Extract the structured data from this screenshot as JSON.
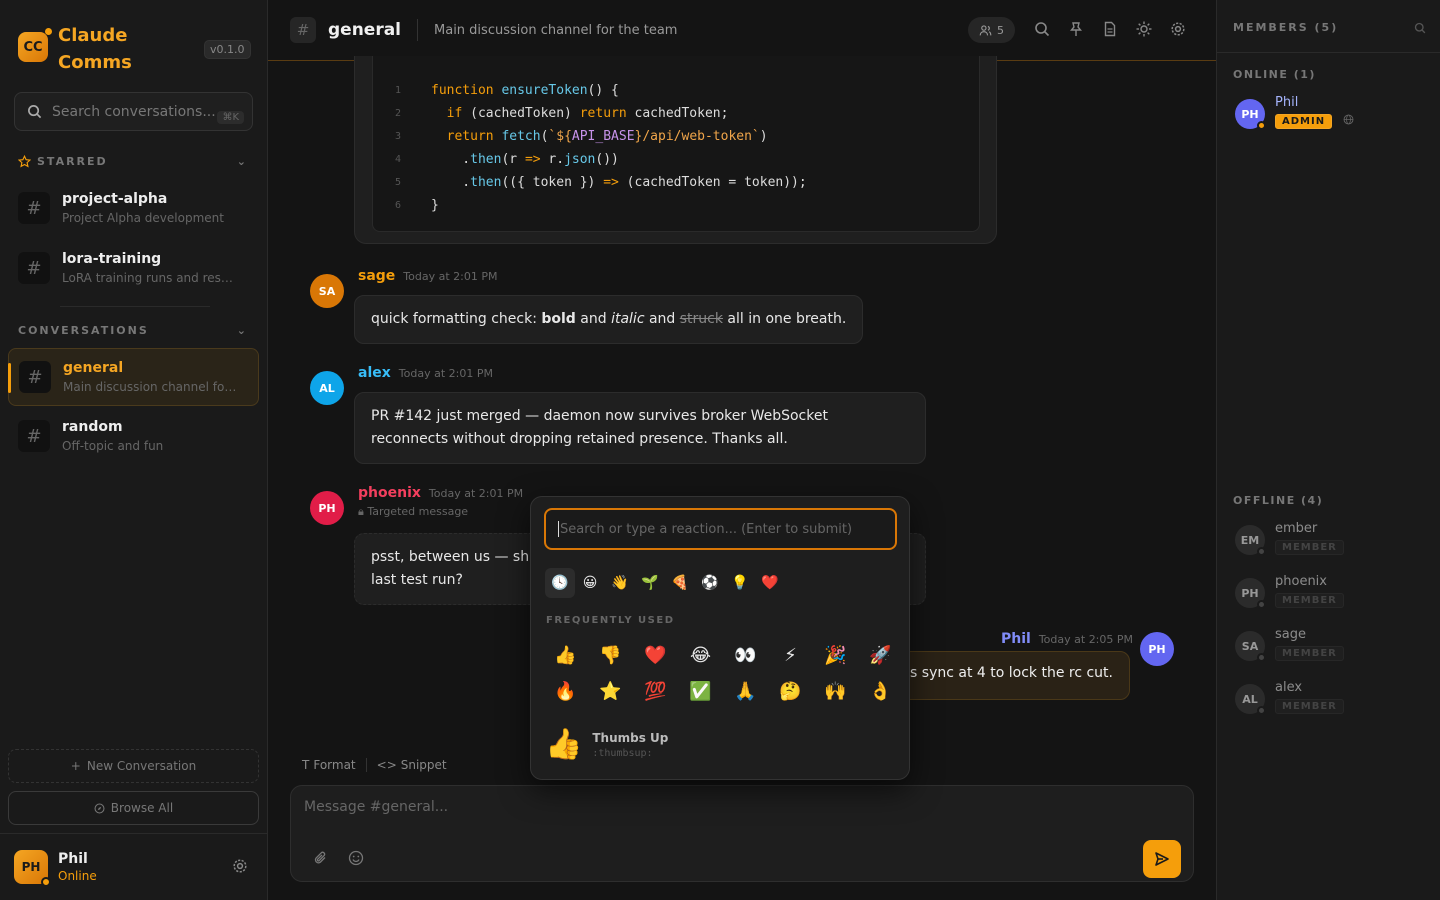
{
  "app": {
    "logo_initials": "CC",
    "name": "Claude Comms",
    "version": "v0.1.0",
    "accent": "#f59e0b"
  },
  "search": {
    "placeholder": "Search conversations...",
    "shortcut": "⌘K"
  },
  "starred": {
    "title": "STARRED",
    "items": [
      {
        "name": "project-alpha",
        "desc": "Project Alpha development"
      },
      {
        "name": "lora-training",
        "desc": "LoRA training runs and results"
      }
    ]
  },
  "conversations": {
    "title": "CONVERSATIONS",
    "items": [
      {
        "name": "general",
        "desc": "Main discussion channel for ..."
      },
      {
        "name": "random",
        "desc": "Off-topic and fun"
      }
    ]
  },
  "sidebar_actions": {
    "new": "New Conversation",
    "browse": "Browse All"
  },
  "user": {
    "initials": "PH",
    "name": "Phil",
    "status": "Online"
  },
  "channel": {
    "name": "general",
    "desc": "Main discussion channel for the team",
    "member_count": "5"
  },
  "code": {
    "lines": [
      "1",
      "2",
      "3",
      "4",
      "5",
      "6"
    ]
  },
  "messages": [
    {
      "initials": "SA",
      "author": "sage",
      "time": "Today at 2:01 PM",
      "pre": "quick formatting check: ",
      "bold": "bold",
      "mid1": " and ",
      "italic": "italic",
      "mid2": " and ",
      "strike": "struck",
      "post": " all in one breath."
    },
    {
      "initials": "AL",
      "author": "alex",
      "time": "Today at 2:01 PM",
      "line1": "PR #142 just merged — daemon now survives broker WebSocket",
      "line2": "reconnects without dropping retained presence. Thanks all."
    },
    {
      "initials": "PH",
      "author": "phoenix",
      "time": "Today at 2:01 PM",
      "targeted": "Targeted message",
      "line1": "psst, between us — sh",
      "line2": "last test run?"
    },
    {
      "initials": "PH",
      "author": "Phil",
      "time": "Today at 2:05 PM",
      "text": "s sync at 4 to lock the rc cut."
    }
  ],
  "composer": {
    "format": "Format",
    "snippet": "Snippet",
    "placeholder": "Message #general..."
  },
  "members": {
    "title": "MEMBERS (5)",
    "online_title": "ONLINE (1)",
    "offline_title": "OFFLINE (4)",
    "online": [
      {
        "initials": "PH",
        "name": "Phil",
        "role": "ADMIN"
      }
    ],
    "offline": [
      {
        "initials": "EM",
        "name": "ember",
        "role": "MEMBER"
      },
      {
        "initials": "PH",
        "name": "phoenix",
        "role": "MEMBER"
      },
      {
        "initials": "SA",
        "name": "sage",
        "role": "MEMBER"
      },
      {
        "initials": "AL",
        "name": "alex",
        "role": "MEMBER"
      }
    ]
  },
  "picker": {
    "placeholder": "Search or type a reaction... (Enter to submit)",
    "categories": [
      "🕓",
      "😀",
      "👋",
      "🌱",
      "🍕",
      "⚽",
      "💡",
      "❤️"
    ],
    "frequent_title": "FREQUENTLY USED",
    "emojis": [
      "👍",
      "👎",
      "❤️",
      "😂",
      "👀",
      "⚡",
      "🎉",
      "🚀",
      "🔥",
      "⭐",
      "💯",
      "✅",
      "🙏",
      "🤔",
      "🙌",
      "👌"
    ],
    "preview": {
      "emoji": "👍",
      "name": "Thumbs Up",
      "code": ":thumbsup:"
    }
  }
}
